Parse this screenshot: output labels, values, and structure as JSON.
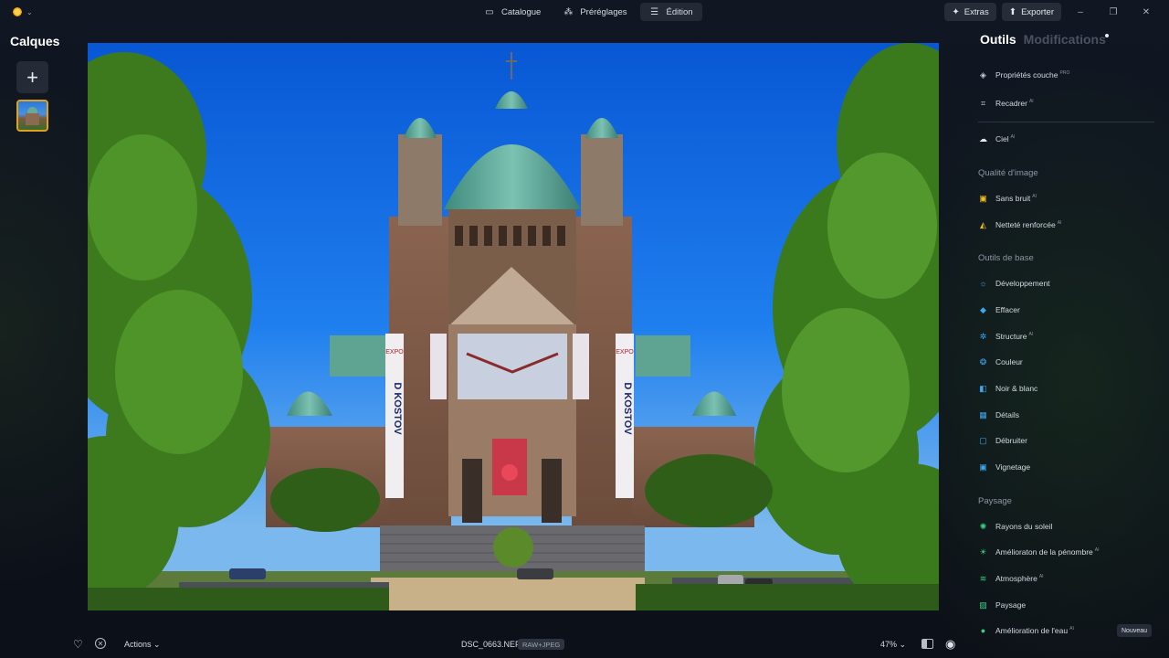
{
  "titlebar": {
    "tabs": [
      {
        "label": "Catalogue",
        "icon": "folder-icon"
      },
      {
        "label": "Préréglages",
        "icon": "magic-wand-icon"
      },
      {
        "label": "Édition",
        "icon": "sliders-icon"
      }
    ],
    "extras_label": "Extras",
    "export_label": "Exporter"
  },
  "layers": {
    "title": "Calques",
    "add_icon": "plus-icon"
  },
  "tools_panel": {
    "tab_tools": "Outils",
    "tab_modifications": "Modifications",
    "items": {
      "layer_props": {
        "label": "Propriétés couche",
        "badge": "PRO"
      },
      "crop": {
        "label": "Recadrer",
        "badge": "AI"
      },
      "sky": {
        "label": "Ciel",
        "badge": "AI"
      },
      "noise": {
        "label": "Sans bruit",
        "badge": "AI"
      },
      "sharpen": {
        "label": "Netteté renforcée",
        "badge": "AI"
      },
      "develop": {
        "label": "Développement"
      },
      "erase": {
        "label": "Effacer"
      },
      "structure": {
        "label": "Structure",
        "badge": "AI"
      },
      "color": {
        "label": "Couleur"
      },
      "bw": {
        "label": "Noir & blanc"
      },
      "details": {
        "label": "Détails"
      },
      "denoise": {
        "label": "Débruiter"
      },
      "vignette": {
        "label": "Vignetage"
      },
      "sunrays": {
        "label": "Rayons du soleil"
      },
      "dusk": {
        "label": "Amélioraton de la pénombre",
        "badge": "AI"
      },
      "atmosphere": {
        "label": "Atmosphère",
        "badge": "AI"
      },
      "landscape": {
        "label": "Paysage"
      },
      "water": {
        "label": "Amélioration de l'eau",
        "badge": "AI"
      }
    },
    "sections": {
      "quality": "Qualité d'image",
      "basic": "Outils de base",
      "landscape": "Paysage"
    },
    "new_badge": "Nouveau"
  },
  "bottom_bar": {
    "actions_label": "Actions",
    "filename": "DSC_0663.NEF",
    "format": "RAW+JPEG",
    "zoom": "47%"
  },
  "photo": {
    "banner_left": "EXPO D KOSTOV",
    "banner_right": "EXPO D KOSTOV"
  },
  "colors": {
    "accent": "#e0a020",
    "sky": "#1a78ee",
    "dome": "#5fa89a"
  }
}
